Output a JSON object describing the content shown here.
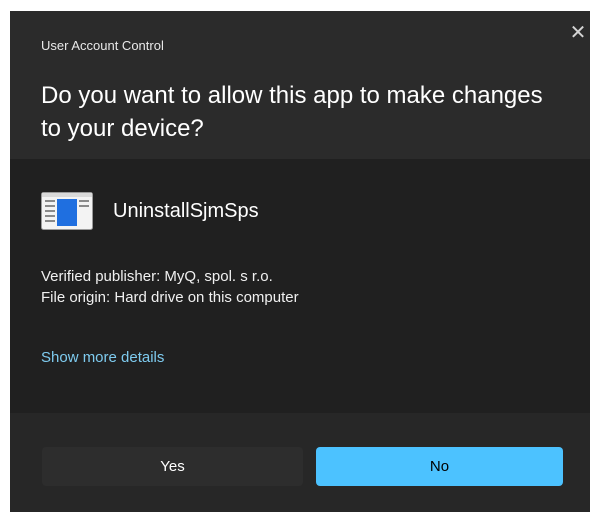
{
  "window": {
    "title": "User Account Control",
    "close_glyph": "✕"
  },
  "header": {
    "question": "Do you want to allow this app to make changes to your device?"
  },
  "app": {
    "icon": "application-window-icon",
    "name": "UninstallSjmSps",
    "verified_publisher": "Verified publisher: MyQ, spol. s r.o.",
    "file_origin": "File origin: Hard drive on this computer"
  },
  "links": {
    "show_more_details": "Show more details"
  },
  "buttons": {
    "yes_label": "Yes",
    "no_label": "No"
  },
  "colors": {
    "accent": "#4cc2ff",
    "link": "#7ecbef",
    "header_bg": "#2b2b2b",
    "body_bg": "#202020",
    "footer_bg": "#272727"
  }
}
